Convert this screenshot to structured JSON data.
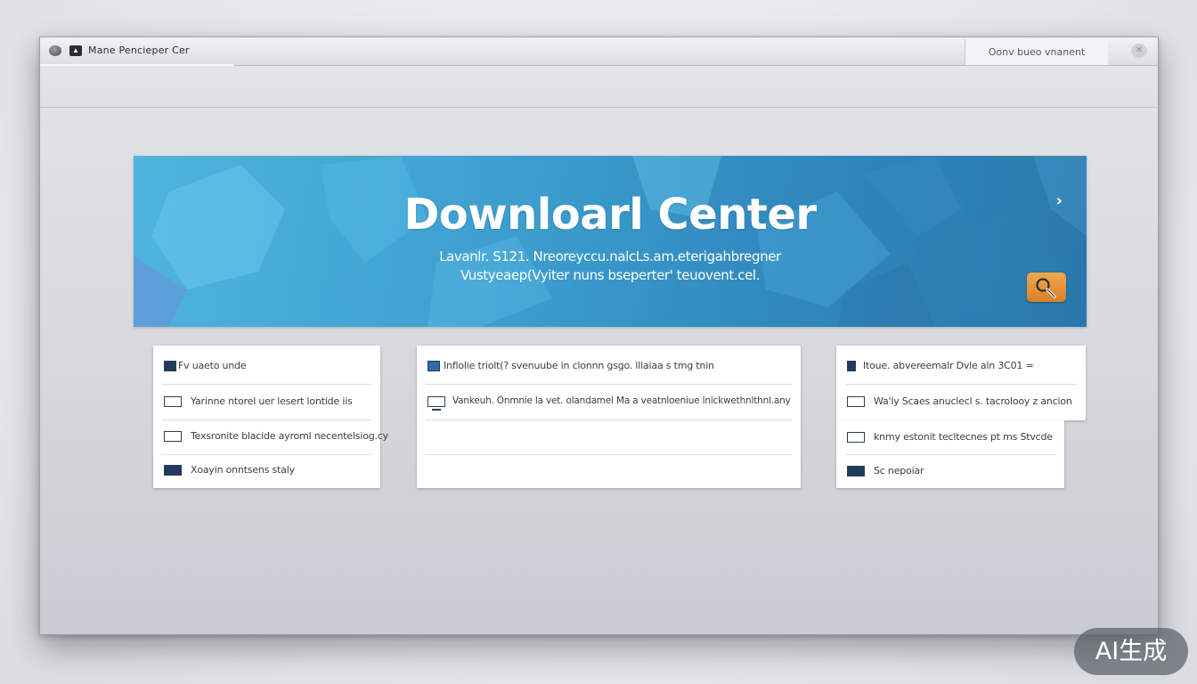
{
  "window": {
    "title": "Mane Pencieper Cer",
    "top_action_label": "Oonv bueo vnanent"
  },
  "hero": {
    "title": "Downloarl Center",
    "subtitle_line1": "Lavanlr. S121. Nreoreyccu.nalcLs.am.eterigahbregner",
    "subtitle_line2": "Vustyeaep(Vyiter nuns bseperter' teuovent.cel.",
    "colors": {
      "bg_start": "#4fb5df",
      "bg_end": "#2a78ab",
      "search_button": "#e8953a"
    }
  },
  "cards": [
    {
      "rows": [
        {
          "icon": "dark-square-icon",
          "text": "Fv uaeto unde"
        },
        {
          "icon": "monitor-icon",
          "text": "Yarinne ntorel uer lesert lontide iis"
        },
        {
          "icon": "monitor-icon",
          "text": "Texsronite blacide ayroml necentelsiog.cy"
        },
        {
          "icon": "monitor-icon",
          "text": "Xoayin onntsens staly"
        }
      ]
    },
    {
      "rows": [
        {
          "icon": "dark-square-icon",
          "text": "Inflolie triolt(? svenuube in clonnn gsgo. lllaiaa s tmg tnin"
        },
        {
          "icon": "tv-icon",
          "text": "Vankeuh. Onmnie la vet. olandamel Ma a veatnloeniue lnickwethnlthnl.any"
        },
        {
          "icon": "",
          "text": ""
        },
        {
          "icon": "",
          "text": ""
        }
      ]
    },
    {
      "rows": [
        {
          "icon": "dark-square-icon",
          "text": "Itoue. abvereemalr Dvle aln 3C01 ="
        },
        {
          "icon": "monitor-icon",
          "text": "Wa'ly Scaes anuclecl s. tacrolooy z ancion"
        },
        {
          "icon": "monitor-icon",
          "text": "knmy estonit tecltecnes pt ms Stvcde"
        },
        {
          "icon": "monitor-icon",
          "text": "Sc nepoiar"
        }
      ]
    }
  ],
  "watermark": {
    "text": "AI生成"
  }
}
